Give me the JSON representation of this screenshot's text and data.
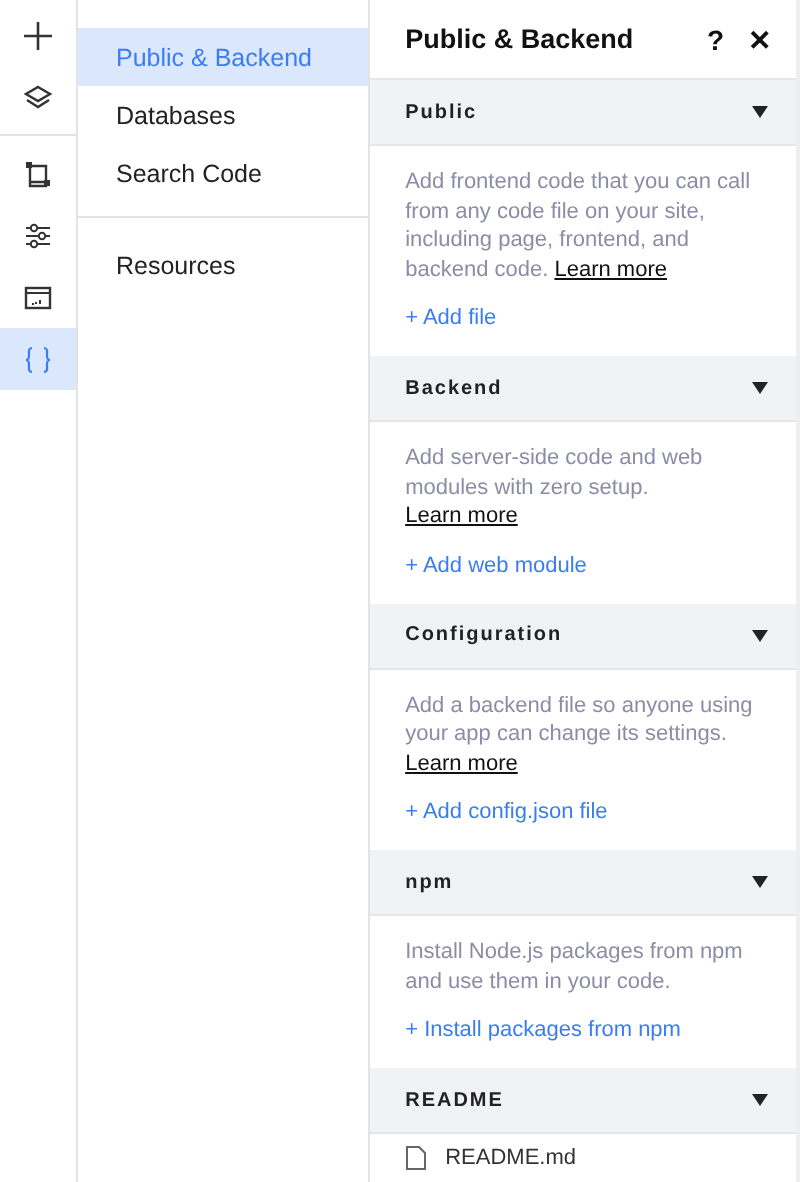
{
  "rail": [
    {
      "selected": false
    },
    {
      "selected": false
    },
    {
      "selected": false
    },
    {
      "selected": false
    },
    {
      "selected": false
    },
    {
      "selected": true
    }
  ],
  "nav": {
    "items": [
      {
        "label": "Public & Backend",
        "selected": true
      },
      {
        "label": "Databases",
        "selected": false
      },
      {
        "label": "Search Code",
        "selected": false
      }
    ],
    "footer_items": [
      {
        "label": "Resources",
        "selected": false
      }
    ]
  },
  "panel": {
    "title": "Public & Backend",
    "help": "?",
    "close": "✕",
    "sections": [
      {
        "kind": "info",
        "title": "Public",
        "description": "Add frontend code that you can call from any code file on your site, including page, frontend, and backend code.",
        "link": "Learn more",
        "action": "+ Add file"
      },
      {
        "kind": "info",
        "title": "Backend",
        "description": "Add server-side code and web modules with zero setup.",
        "link": "Learn more",
        "action": "+ Add web module"
      },
      {
        "kind": "info",
        "title": "Configuration",
        "description": "Add a backend file so anyone using your app can change its settings.",
        "link": "Learn more",
        "action": "+ Add config.json file"
      },
      {
        "kind": "info",
        "title": "npm",
        "description": "Install Node.js packages from npm and use them in your code.",
        "action": "+ Install packages from npm"
      },
      {
        "kind": "files",
        "title": "README",
        "files": [
          "README.md"
        ]
      }
    ]
  }
}
